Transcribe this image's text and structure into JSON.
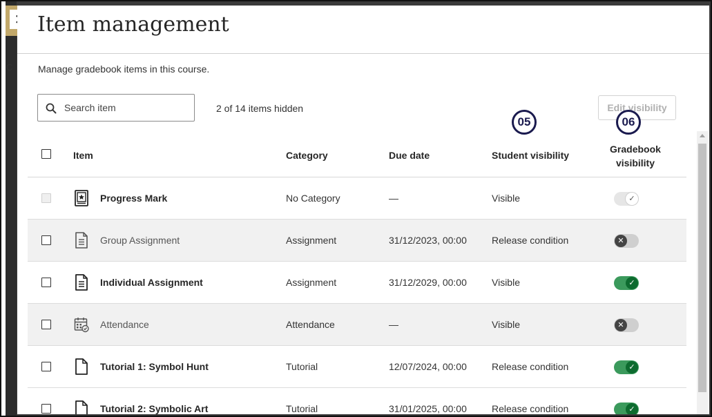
{
  "panel": {
    "title": "Item management",
    "description": "Manage gradebook items in this course.",
    "background_label_fragment": "C"
  },
  "search": {
    "placeholder": "Search item",
    "value": ""
  },
  "hidden_count": "2 of 14 items hidden",
  "edit_visibility_label": "Edit visibility",
  "callouts": [
    "05",
    "06"
  ],
  "columns": {
    "item": "Item",
    "category": "Category",
    "due_date": "Due date",
    "student_visibility": "Student visibility",
    "gradebook_visibility_line1": "Gradebook",
    "gradebook_visibility_line2": "visibility"
  },
  "rows": [
    {
      "name": "Progress Mark",
      "icon": "progress-mark-icon",
      "category": "No Category",
      "due": "—",
      "visibility": "Visible",
      "gradebook": "locked-on",
      "checkbox_disabled": true,
      "shaded": false,
      "muted": false
    },
    {
      "name": "Group Assignment",
      "icon": "document-icon",
      "category": "Assignment",
      "due": "31/12/2023, 00:00",
      "visibility": "Release condition",
      "gradebook": "off",
      "checkbox_disabled": false,
      "shaded": true,
      "muted": true
    },
    {
      "name": "Individual Assignment",
      "icon": "document-icon",
      "category": "Assignment",
      "due": "31/12/2029, 00:00",
      "visibility": "Visible",
      "gradebook": "on",
      "checkbox_disabled": false,
      "shaded": false,
      "muted": false
    },
    {
      "name": "Attendance",
      "icon": "attendance-calendar-icon",
      "category": "Attendance",
      "due": "—",
      "visibility": "Visible",
      "gradebook": "off",
      "checkbox_disabled": false,
      "shaded": true,
      "muted": true
    },
    {
      "name": "Tutorial 1: Symbol Hunt",
      "icon": "blank-file-icon",
      "category": "Tutorial",
      "due": "12/07/2024, 00:00",
      "visibility": "Release condition",
      "gradebook": "on",
      "checkbox_disabled": false,
      "shaded": false,
      "muted": false
    },
    {
      "name": "Tutorial 2: Symbolic Art",
      "icon": "blank-file-icon",
      "category": "Tutorial",
      "due": "31/01/2025, 00:00",
      "visibility": "Release condition",
      "gradebook": "on",
      "checkbox_disabled": false,
      "shaded": false,
      "muted": false
    }
  ],
  "colors": {
    "toggle_on_track": "#3b9a5c",
    "toggle_on_knob": "#0d6b2f",
    "toggle_off_knob": "#444444",
    "callout": "#1a1a4e",
    "close_tab": "#c2a86a",
    "row_shade": "#f1f1f1"
  }
}
